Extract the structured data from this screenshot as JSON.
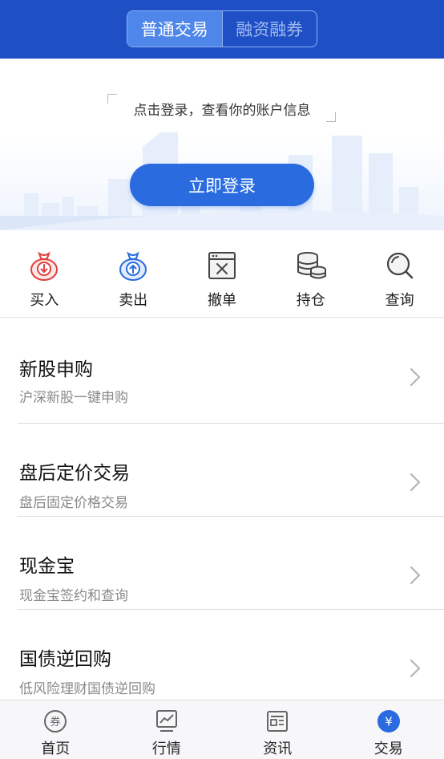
{
  "header": {
    "tabs": [
      {
        "label": "普通交易",
        "active": true
      },
      {
        "label": "融资融券",
        "active": false
      }
    ]
  },
  "login": {
    "prompt": "点击登录，查看你的账户信息",
    "button_label": "立即登录"
  },
  "quick_actions": [
    {
      "label": "买入",
      "icon": "buy-moneybag-icon"
    },
    {
      "label": "卖出",
      "icon": "sell-moneybag-icon"
    },
    {
      "label": "撤单",
      "icon": "cancel-order-icon"
    },
    {
      "label": "持仓",
      "icon": "coin-stack-icon"
    },
    {
      "label": "查询",
      "icon": "search-icon"
    }
  ],
  "functions": [
    {
      "title": "新股申购",
      "subtitle": "沪深新股一键申购"
    },
    {
      "title": "盘后定价交易",
      "subtitle": "盘后固定价格交易"
    },
    {
      "title": "现金宝",
      "subtitle": "现金宝签约和查询"
    },
    {
      "title": "国债逆回购",
      "subtitle": "低风险理财国债逆回购"
    }
  ],
  "tabbar": [
    {
      "label": "首页",
      "icon": "home-coupon-icon",
      "active": false
    },
    {
      "label": "行情",
      "icon": "market-chart-icon",
      "active": false
    },
    {
      "label": "资讯",
      "icon": "news-icon",
      "active": false
    },
    {
      "label": "交易",
      "icon": "trade-yuan-icon",
      "active": true
    }
  ],
  "colors": {
    "header_bg": "#1f4fc4",
    "accent": "#2a6be0",
    "buy_red": "#e0413e",
    "sell_blue": "#2a6be0"
  }
}
